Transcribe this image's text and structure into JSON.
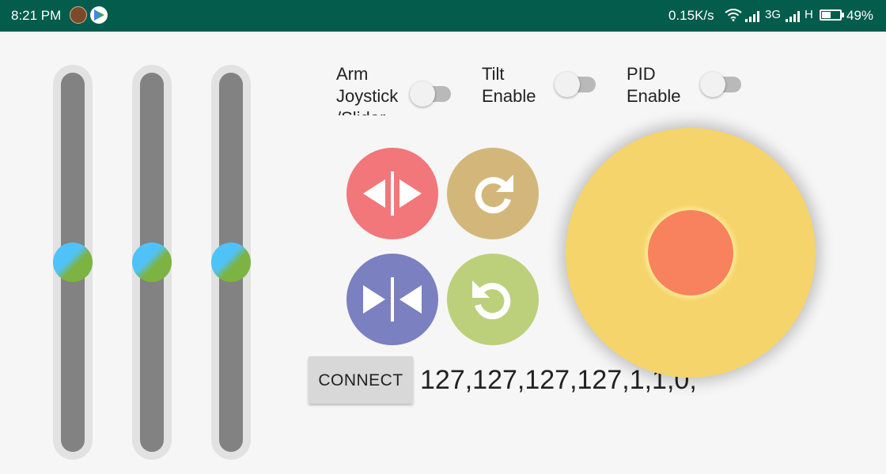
{
  "status_bar": {
    "time": "8:21 PM",
    "app_icons": [
      "avatar-icon",
      "play-store-icon"
    ],
    "network_speed": "0.15K/s",
    "network_3g": "3G",
    "network_type": "H",
    "battery_percent": "49%",
    "battery_level": 0.49
  },
  "sliders": [
    {
      "name": "slider-1",
      "value": 0.5
    },
    {
      "name": "slider-2",
      "value": 0.5
    },
    {
      "name": "slider-3",
      "value": 0.5
    }
  ],
  "switches": {
    "arm": {
      "label": "Arm Joystick /Slider",
      "on": false
    },
    "tilt": {
      "label": "Tilt Enable",
      "on": false
    },
    "pid": {
      "label": "PID Enable",
      "on": false
    }
  },
  "buttons": {
    "spread": {
      "icon": "spread-arrows-icon",
      "color": "#f1777a"
    },
    "rotate_cw": {
      "icon": "rotate-clockwise-icon",
      "color": "#d3b77a"
    },
    "squeeze": {
      "icon": "squeeze-arrows-icon",
      "color": "#7a80c0"
    },
    "rotate_ccw": {
      "icon": "rotate-counterclockwise-icon",
      "color": "#bcd07c"
    }
  },
  "connect": {
    "label": "CONNECT"
  },
  "data_output": "127,127,127,127,1,1,0;",
  "joystick": {
    "base_color": "#f6d46c",
    "knob_color": "#f7825d",
    "x": 0,
    "y": 0
  }
}
